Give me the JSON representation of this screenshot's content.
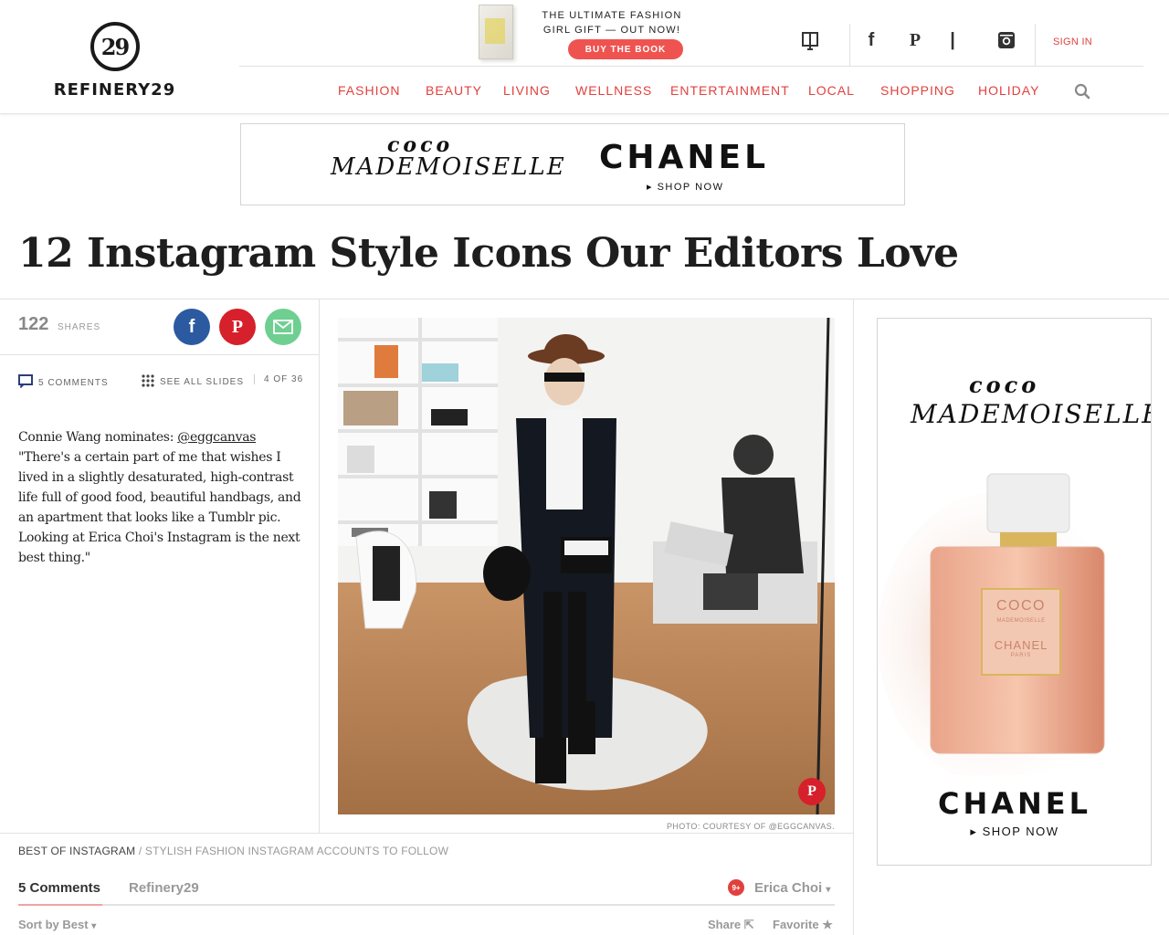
{
  "brand": {
    "logo_mark": "29",
    "logo_text": "REFINERY29"
  },
  "promo": {
    "line1": "THE ULTIMATE FASHION",
    "line2": "GIRL GIFT — OUT NOW!",
    "button": "BUY THE BOOK"
  },
  "header": {
    "signin": "SIGN IN",
    "icons": [
      "tablet-icon",
      "facebook-icon",
      "pinterest-icon",
      "tumblr-icon",
      "instagram-icon"
    ]
  },
  "nav": {
    "items": [
      "FASHION",
      "BEAUTY",
      "LIVING",
      "WELLNESS",
      "ENTERTAINMENT",
      "LOCAL",
      "SHOPPING",
      "HOLIDAY"
    ]
  },
  "banner_ad": {
    "coco": "coco",
    "mademoiselle": "MADEMOISELLE",
    "brand": "CHANEL",
    "cta": "SHOP NOW"
  },
  "article": {
    "title": "12 Instagram Style Icons Our Editors Love",
    "share_count": "122",
    "share_label": "SHARES",
    "comments": "5 COMMENTS",
    "see_all": "SEE ALL SLIDES",
    "slide_pos": "4 OF 36",
    "nominator": "Connie Wang nominates: ",
    "handle": "@eggcanvas",
    "quote": "\"There's a certain part of me that wishes I lived in a slightly desaturated, high-contrast life full of good food, beautiful handbags, and an apartment that looks like a Tumblr pic. Looking at Erica Choi's Instagram is the next best thing.\"",
    "photo_credit": "PHOTO: COURTESY OF @EGGCANVAS."
  },
  "side_ad": {
    "coco": "coco",
    "mademoiselle": "MADEMOISELLE",
    "bottle_coco": "COCO",
    "bottle_made": "MADEMOISELLE",
    "bottle_chanel": "CHANEL",
    "bottle_paris": "PARIS",
    "brand": "CHANEL",
    "cta": "SHOP NOW"
  },
  "breadcrumb": {
    "section": "BEST OF INSTAGRAM",
    "separator": " / ",
    "page": "STYLISH FASHION INSTAGRAM ACCOUNTS TO FOLLOW"
  },
  "comments": {
    "tab_count": "5 Comments",
    "tab_site": "Refinery29",
    "badge": "9+",
    "user": "Erica Choi",
    "sort": "Sort by Best",
    "share": "Share",
    "favorite": "Favorite"
  },
  "colors": {
    "accent": "#e0413f",
    "facebook": "#2c5aa0",
    "pinterest": "#d6202b",
    "email": "#6ecf91"
  }
}
